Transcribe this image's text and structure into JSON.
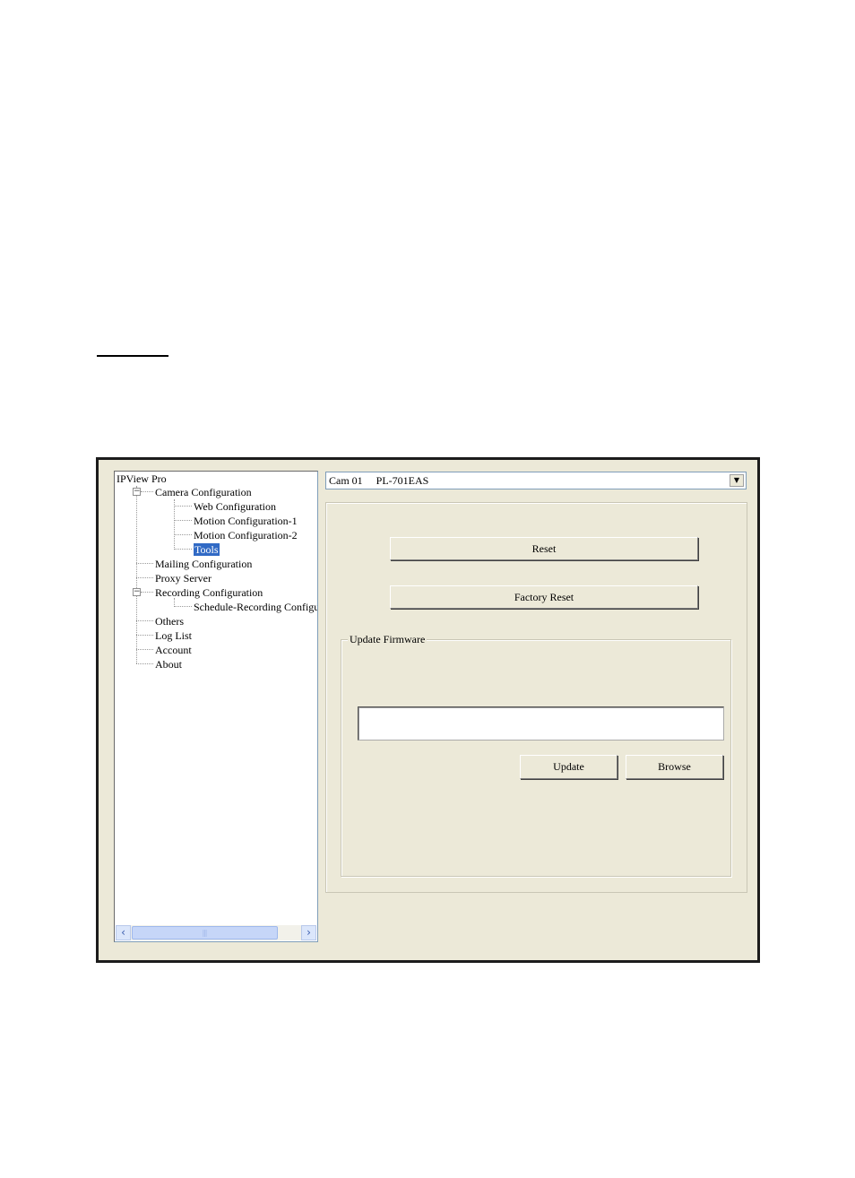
{
  "tree": {
    "root": "IPView Pro",
    "items": [
      {
        "label": "Camera Configuration"
      },
      {
        "label": "Web Configuration"
      },
      {
        "label": "Motion Configuration-1"
      },
      {
        "label": "Motion Configuration-2"
      },
      {
        "label": "Tools"
      },
      {
        "label": "Mailing Configuration"
      },
      {
        "label": "Proxy Server"
      },
      {
        "label": "Recording Configuration"
      },
      {
        "label": "Schedule-Recording Configu"
      },
      {
        "label": "Others"
      },
      {
        "label": "Log List"
      },
      {
        "label": "Account"
      },
      {
        "label": "About"
      }
    ],
    "expander_symbol": "−",
    "scroll_thumb_grip": "|||"
  },
  "camera_select": {
    "value": "Cam 01     PL-701EAS"
  },
  "tools": {
    "reset_label": "Reset",
    "factory_reset_label": "Factory Reset",
    "firmware_group_label": "Update Firmware",
    "firmware_path_value": "",
    "update_label": "Update",
    "browse_label": "Browse"
  },
  "colors": {
    "window_bg": "#ece9d8",
    "selection": "#316ac5",
    "frame": "#1c1c1c"
  },
  "icons": {
    "expander": "minus-box-icon",
    "scroll_left": "chevron-left-icon",
    "scroll_right": "chevron-right-icon",
    "dropdown": "chevron-down-icon"
  }
}
